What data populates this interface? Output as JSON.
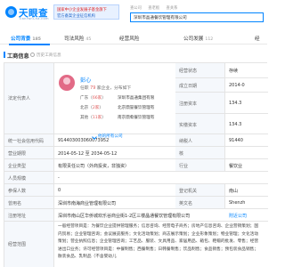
{
  "header": {
    "logo_text": "天眼查",
    "logo_sub": "TianYanCha.com",
    "banner_line1": "国家中小企业发展子基金旗下",
    "banner_line2": "官方备案企业征信机构",
    "nav": [
      "查公司",
      "查老板",
      "查关系"
    ],
    "search_value": "深圳市晶通餐饮管理有限公司"
  },
  "tabs": [
    {
      "label": "公司背景",
      "count": "185"
    },
    {
      "label": "司法风险",
      "count": "45"
    },
    {
      "label": "经营风险",
      "count": ""
    },
    {
      "label": "公司发展",
      "count": "112"
    },
    {
      "label": "经",
      "count": ""
    }
  ],
  "section": {
    "title": "工商信息",
    "history": "历史工商信息"
  },
  "table": {
    "legal_rep_label": "法定代表人",
    "legal_rep": {
      "name": "彭心",
      "meta_prefix": "任职",
      "meta_count": "79",
      "meta_suffix": "家企业，分布如下",
      "rows": [
        {
          "region": "广东",
          "count": "66家",
          "company": "深圳市晶通集团有限"
        },
        {
          "region": "北京",
          "count": "2家",
          "company": "北京鼎誉餐饮管理有"
        },
        {
          "region": "其他",
          "count": "11家",
          "company": "南京鼎肴餐饮管理有"
        }
      ],
      "more": "他的所有公司"
    },
    "right_labels": [
      "经营状态",
      "成立日期",
      "注册资本",
      "实缴资本"
    ],
    "right_values": [
      "存续",
      "2014-0",
      "134.3",
      "134.3"
    ],
    "credit_code_label": "统一社会信用代码",
    "credit_code": "914403003060073952",
    "tax_id_label": "纳税人",
    "tax_id": "91440",
    "term_label": "营业期限",
    "term": "2014-05-12 至 2034-05-12",
    "approve_label": "核",
    "company_type_label": "企业类型",
    "company_type": "有限责任公司（外商投资，非独资）",
    "industry_label": "行业",
    "industry": "餐饮业",
    "staff_label": "人员规模",
    "staff": "-",
    "insured_label": "参保人数",
    "insured": "0",
    "registry_label": "登记机关",
    "registry": "南山",
    "former_name_label": "曾用名",
    "former_name": "深圳市南海商业管理有限公司",
    "en_name_label": "英文名",
    "en_name": "Shenzh",
    "address_label": "注册地址",
    "address": "深圳市南山区华侨城欢乐谷商业街1-2区三楼晶通餐饮管理有限公司",
    "address_link": "附近公司",
    "scope_label": "经营范围",
    "scope": "一般经营项目是：为餐饮企业提供管理服务；信息咨询、经营电子商务；房地产信息咨询、企业营销策划；国内贸易；企业管理咨询；会议展览服务；文化活动策划；商志展示策划；企业形象策划；物业管理；文化活动策划；营业执照信息；企业管理咨询；工艺品、服装、文具用品、家居用品、箱包、鞋帽的批发、零售；经营进出口业务；许可经营项目是：中餐制售；西餐制售；日韩餐制售；饮品制售；食品销售；预包装食品销售；散装食品、乳制品（不含婴幼儿"
  }
}
